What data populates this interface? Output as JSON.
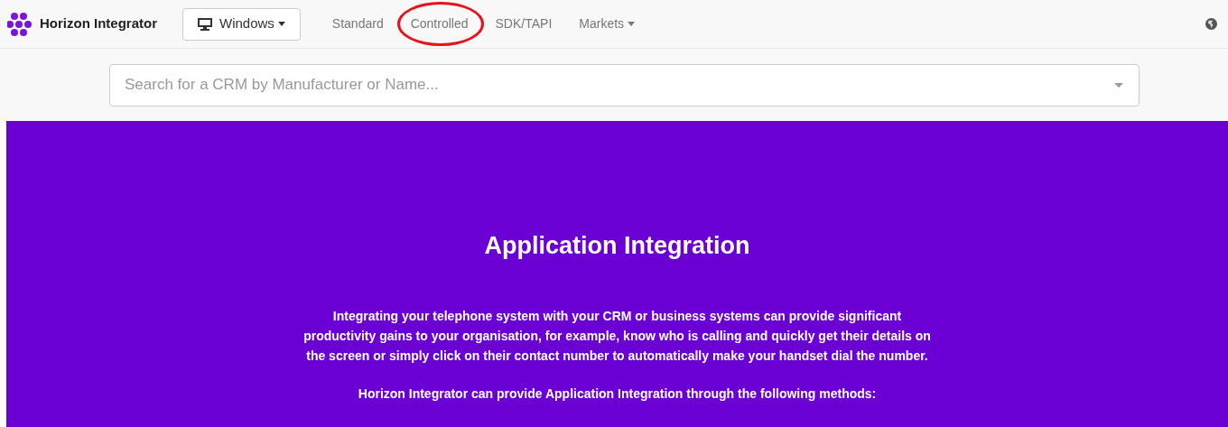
{
  "brand": {
    "name": "Horizon Integrator"
  },
  "platform_button": {
    "label": "Windows"
  },
  "nav": [
    {
      "label": "Standard",
      "dropdown": false,
      "circled": false
    },
    {
      "label": "Controlled",
      "dropdown": false,
      "circled": true
    },
    {
      "label": "SDK/TAPI",
      "dropdown": false,
      "circled": false
    },
    {
      "label": "Markets",
      "dropdown": true,
      "circled": false
    }
  ],
  "search": {
    "placeholder": "Search for a CRM by Manufacturer or Name..."
  },
  "hero": {
    "title": "Application Integration",
    "paragraphs": [
      "Integrating your telephone system with your CRM or business systems can provide significant productivity gains to your organisation, for example, know who is calling and quickly get their details on the screen or simply click on their contact number to automatically make your handset dial the number.",
      "Horizon Integrator can provide Application Integration through the following methods:"
    ]
  }
}
